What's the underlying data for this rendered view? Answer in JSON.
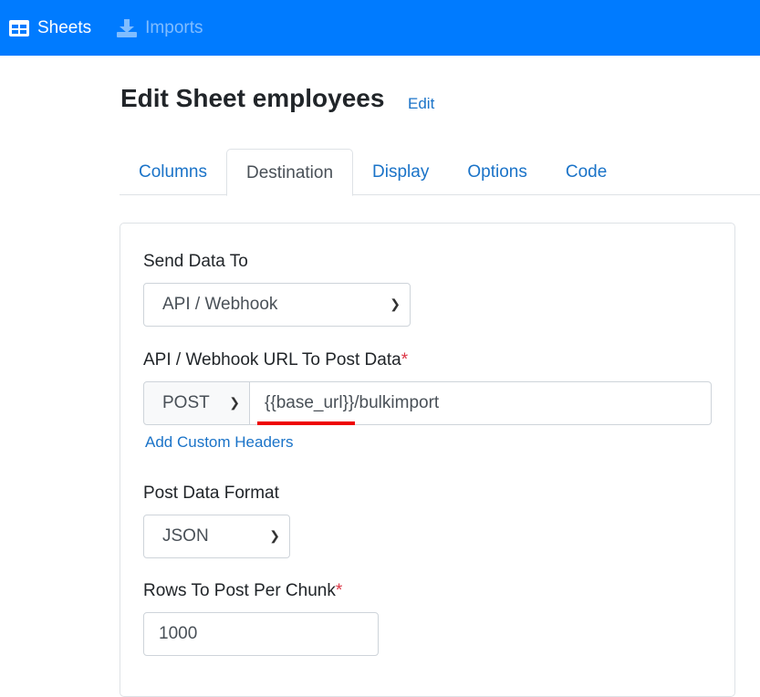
{
  "nav": {
    "sheets": "Sheets",
    "imports": "Imports"
  },
  "header": {
    "title": "Edit Sheet employees",
    "edit": "Edit"
  },
  "tabs": [
    "Columns",
    "Destination",
    "Display",
    "Options",
    "Code"
  ],
  "form": {
    "send_label": "Send Data To",
    "send_value": "API / Webhook",
    "url_label": "API / Webhook URL To Post Data",
    "required": "*",
    "method": "POST",
    "url": "{{base_url}}/bulkimport",
    "headers_link": "Add Custom Headers",
    "format_label": "Post Data Format",
    "format_value": "JSON",
    "rows_label": "Rows To Post Per Chunk",
    "rows_value": "1000"
  }
}
